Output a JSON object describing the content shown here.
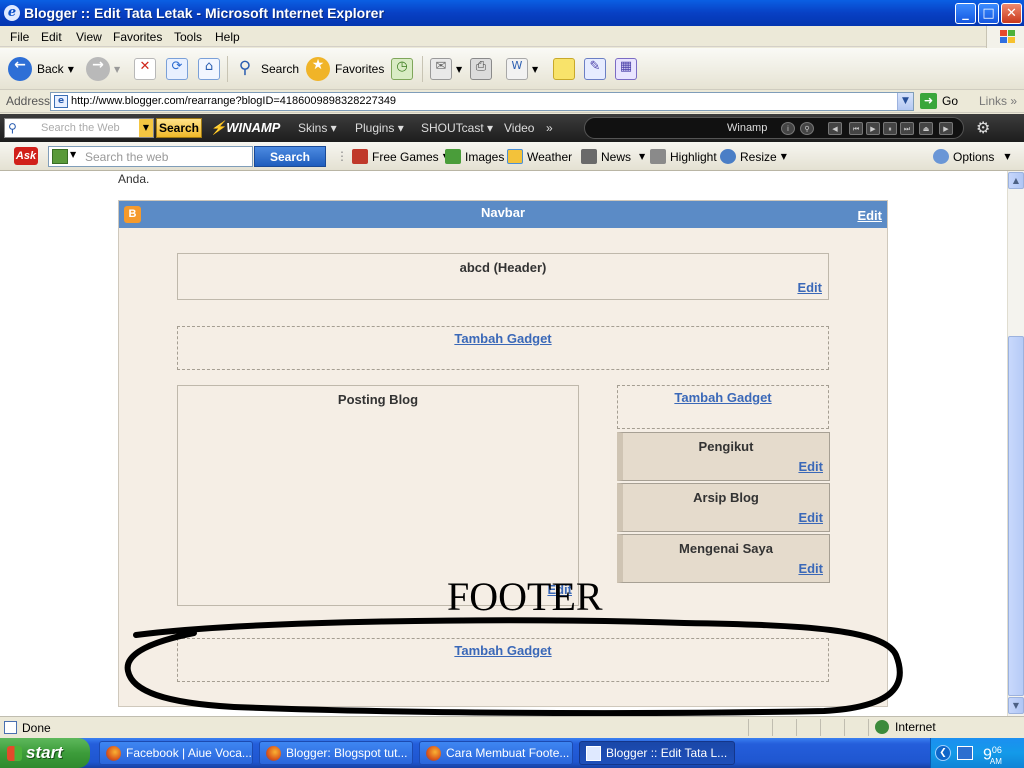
{
  "window": {
    "title": "Blogger :: Edit Tata Letak - Microsoft Internet Explorer",
    "buttons": {
      "minimize": "_",
      "maximize": "□",
      "close": "✕"
    }
  },
  "menu": [
    "File",
    "Edit",
    "View",
    "Favorites",
    "Tools",
    "Help"
  ],
  "toolbar": {
    "back": "Back",
    "search": "Search",
    "favorites": "Favorites"
  },
  "address": {
    "label": "Address",
    "url": "http://www.blogger.com/rearrange?blogID=4186009898328227349",
    "go": "Go",
    "links": "Links"
  },
  "winamp": {
    "search_placeholder": "Search the Web",
    "search_button": "Search",
    "logo": "WINAMP",
    "menus": [
      "Skins",
      "Plugins",
      "SHOUTcast",
      "Video"
    ],
    "more": "»",
    "player_label": "Winamp"
  },
  "ask": {
    "logo": "Ask",
    "search_placeholder": "Search the web",
    "search_button": "Search",
    "items": [
      "Free Games",
      "Images",
      "Weather",
      "News",
      "Highlight",
      "Resize"
    ],
    "options": "Options"
  },
  "page": {
    "intro_tail": "Anda.",
    "navbar": {
      "title": "Navbar",
      "edit": "Edit"
    },
    "header_widget": {
      "title": "abcd (Header)",
      "edit": "Edit"
    },
    "add_gadget": "Tambah Gadget",
    "main_column": {
      "title": "Posting Blog",
      "edit": "Edit"
    },
    "sidebar": [
      {
        "title": "Pengikut",
        "edit": "Edit"
      },
      {
        "title": "Arsip Blog",
        "edit": "Edit"
      },
      {
        "title": "Mengenai Saya",
        "edit": "Edit"
      }
    ],
    "annotation": "FOOTER"
  },
  "status": {
    "text": "Done",
    "zone": "Internet"
  },
  "taskbar": {
    "start": "start",
    "tasks": [
      "Facebook | Aiue Voca...",
      "Blogger: Blogspot tut...",
      "Cara Membuat Foote...",
      "Blogger :: Edit Tata L..."
    ],
    "clock_hour": "9",
    "clock_min": "06",
    "clock_ampm": "AM"
  }
}
